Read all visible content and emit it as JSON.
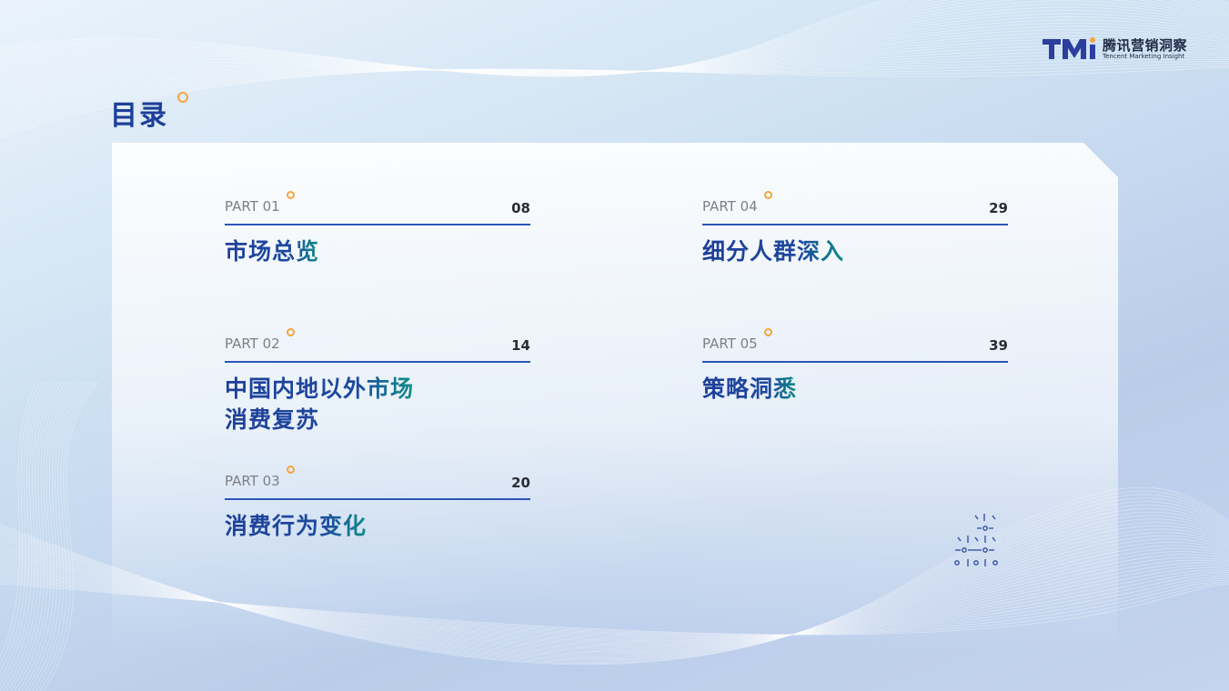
{
  "brand": {
    "logo_letters": "TMI",
    "name_cn": "腾讯营销洞察",
    "name_en": "Tencent Marketing Insight"
  },
  "page_title": "目录",
  "items": [
    {
      "part": "PART 01",
      "page": "08",
      "title_lines": [
        "市场总览"
      ]
    },
    {
      "part": "PART 02",
      "page": "14",
      "title_lines": [
        "中国内地以外市场",
        "消费复苏"
      ]
    },
    {
      "part": "PART 03",
      "page": "20",
      "title_lines": [
        "消费行为变化"
      ]
    },
    {
      "part": "PART 04",
      "page": "29",
      "title_lines": [
        "细分人群深入"
      ]
    },
    {
      "part": "PART 05",
      "page": "39",
      "title_lines": [
        "策略洞悉"
      ]
    }
  ],
  "colors": {
    "accent_blue": "#1d3f99",
    "accent_orange": "#f5a53a",
    "rule_blue": "#2c56b8",
    "teal": "#0f8f86"
  }
}
